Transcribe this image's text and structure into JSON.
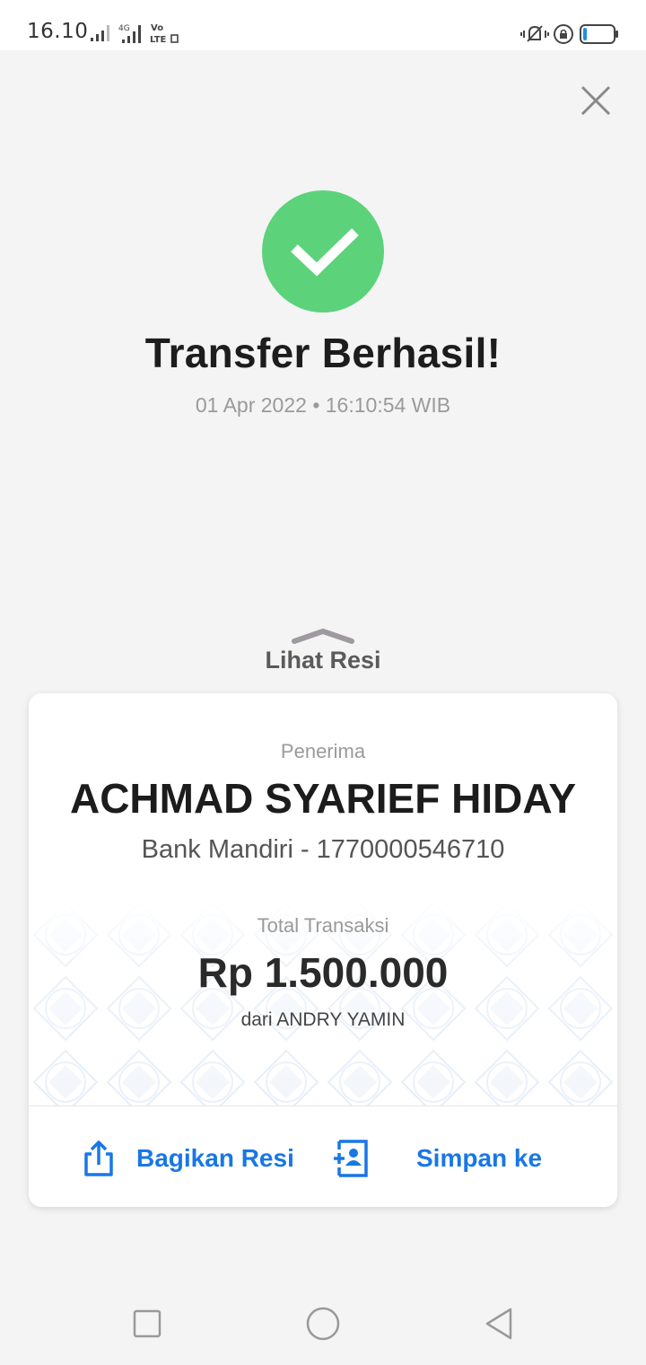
{
  "status_bar": {
    "time": "16.10",
    "network_label_top": "Vo",
    "network_label_bottom": "LTE",
    "network_4g": "4G",
    "icons": [
      "signal-icon",
      "signal-4g-icon",
      "volte-icon",
      "mute-vibrate-icon",
      "rotation-lock-icon",
      "battery-icon"
    ],
    "battery_level": 0.1
  },
  "header": {
    "close_icon": "close-icon"
  },
  "result": {
    "icon": "check-circle-icon",
    "icon_color": "#5cd27b",
    "title": "Transfer Berhasil!",
    "datetime": "01 Apr 2022 • 16:10:54 WIB"
  },
  "receipt_toggle": {
    "label": "Lihat Resi",
    "icon": "chevron-up-icon"
  },
  "receipt": {
    "recipient_label": "Penerima",
    "recipient_name": "ACHMAD SYARIEF HIDAY",
    "bank_account": "Bank Mandiri - 1770000546710",
    "total_label": "Total Transaksi",
    "amount": "Rp 1.500.000",
    "from": "dari ANDRY YAMIN"
  },
  "actions": {
    "share_label": "Bagikan Resi",
    "share_icon": "share-icon",
    "save_label": "Simpan ke",
    "save_icon": "add-contact-icon",
    "accent_color": "#1877e6"
  },
  "nav_bar": {
    "recents_icon": "square-icon",
    "home_icon": "circle-icon",
    "back_icon": "back-triangle-icon"
  }
}
